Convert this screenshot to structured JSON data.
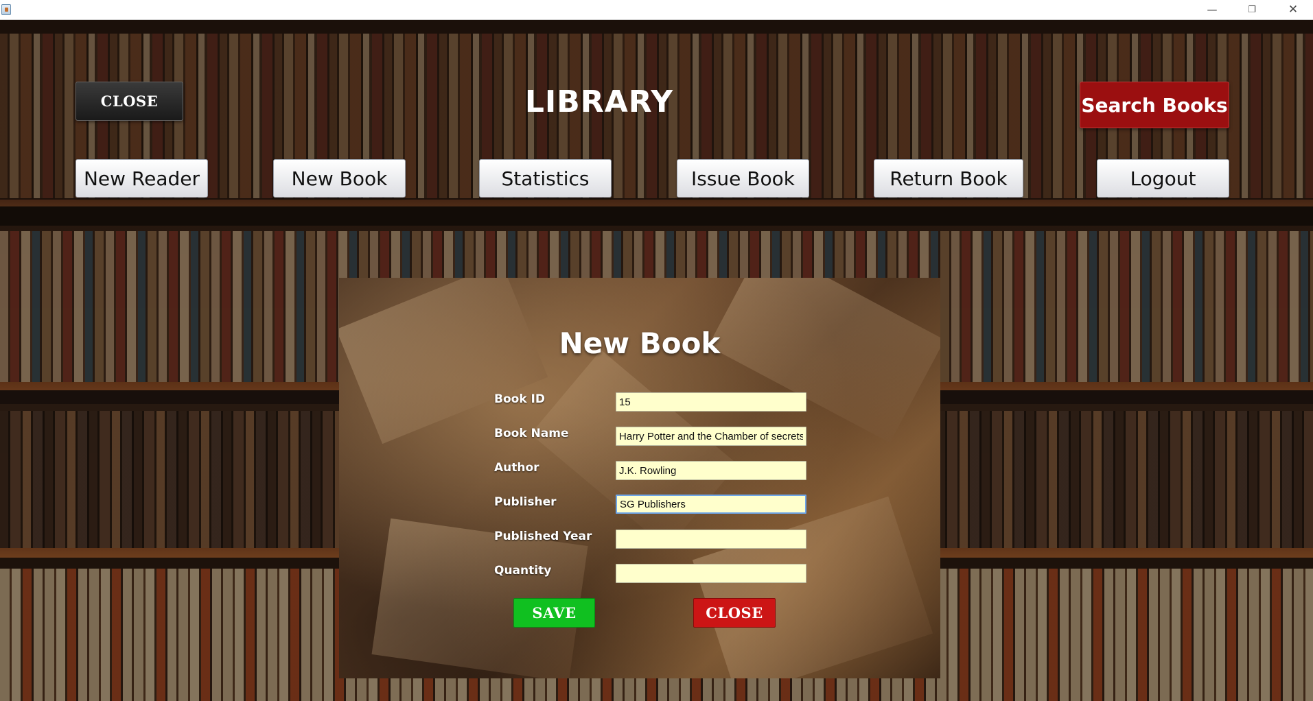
{
  "window": {
    "minimize_glyph": "—",
    "maximize_glyph": "❐",
    "close_glyph": "✕"
  },
  "header": {
    "close_label": "CLOSE",
    "title": "LIBRARY",
    "search_label": "Search Books"
  },
  "nav": {
    "new_reader": "New Reader",
    "new_book": "New Book",
    "statistics": "Statistics",
    "issue_book": "Issue Book",
    "return_book": "Return Book",
    "logout": "Logout"
  },
  "dialog": {
    "title": "New Book",
    "fields": {
      "book_id": {
        "label": "Book ID",
        "value": "15"
      },
      "book_name": {
        "label": "Book Name",
        "value": "Harry Potter and the Chamber of secrets"
      },
      "author": {
        "label": "Author",
        "value": "J.K. Rowling"
      },
      "publisher": {
        "label": "Publisher",
        "value": "SG Publishers"
      },
      "published_year": {
        "label": "Published Year",
        "value": ""
      },
      "quantity": {
        "label": "Quantity",
        "value": ""
      }
    },
    "save_label": "SAVE",
    "close_label": "CLOSE"
  },
  "colors": {
    "search_button": "#9b0f10",
    "save_button": "#10c020",
    "close_button": "#cc1515",
    "input_background": "#ffffcc"
  }
}
